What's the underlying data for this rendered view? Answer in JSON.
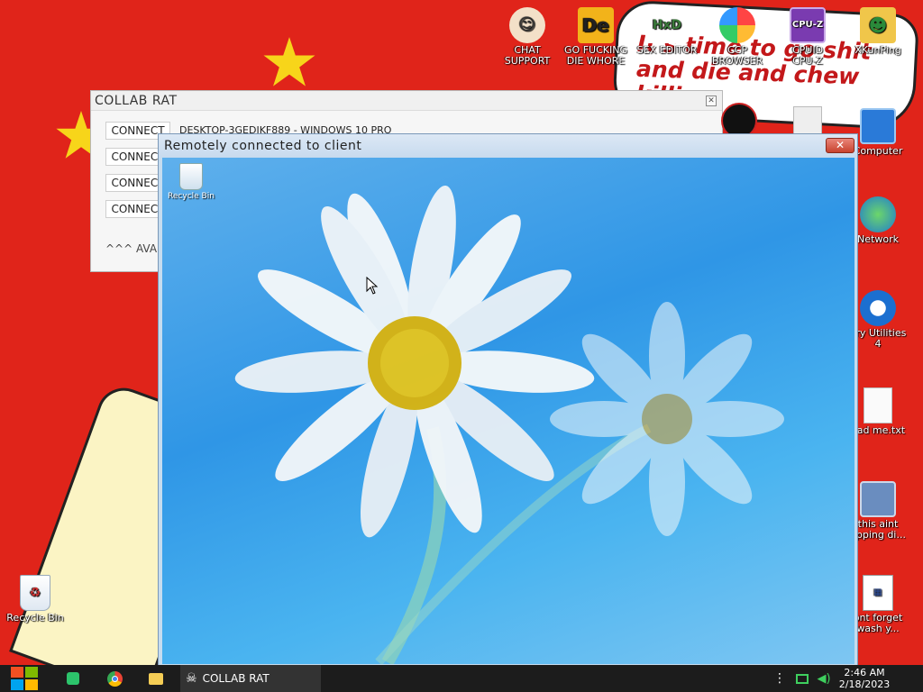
{
  "wallpaper": {
    "bubble_text": "It's time to go shit and die and chew killing"
  },
  "desktop_icons": [
    {
      "id": "chat-support",
      "label": "CHAT\nSUPPORT"
    },
    {
      "id": "go-die",
      "label": "GO FUCKING\nDIE WHORE",
      "glyph": "De"
    },
    {
      "id": "sex-editor",
      "label": "SEX EDITOR",
      "glyph": "HxD"
    },
    {
      "id": "ccp-browser",
      "label": "CCP\nBROWSER"
    },
    {
      "id": "cpuid",
      "label": "CPUID\nCPU-Z",
      "glyph": "CPU-Z"
    },
    {
      "id": "xkunping",
      "label": "XKunPing"
    },
    {
      "id": "computer",
      "label": "Computer"
    },
    {
      "id": "network",
      "label": "Network"
    },
    {
      "id": "glary",
      "label": "ary Utilities\n4"
    },
    {
      "id": "readme",
      "label": "ead me.txt"
    },
    {
      "id": "this-aint",
      "label": "this aint\nopping di..."
    },
    {
      "id": "dont-forget",
      "label": "ont forget\nwash y..."
    },
    {
      "id": "recycle-bin",
      "label": "Recycle Bin"
    }
  ],
  "rat_window": {
    "title": "COLLAB RAT",
    "close": "✕",
    "buttons": [
      "CONNECT",
      "CONNECT",
      "CONNECT",
      "CONNECT"
    ],
    "client": "DESKTOP-3GEDJKF889 - WINDOWS 10 PRO",
    "available": "^^^ AVAILA"
  },
  "remote_window": {
    "title": "Remotely connected to client",
    "close": "✕",
    "recycle_bin": "Recycle Bin"
  },
  "taskbar": {
    "active_label": "COLLAB RAT",
    "time": "2:46 AM",
    "date": "2/18/2023"
  }
}
